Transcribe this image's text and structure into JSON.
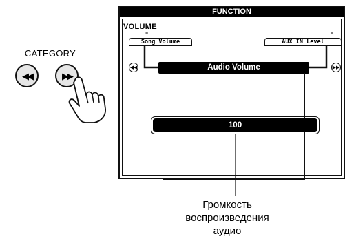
{
  "left_panel": {
    "category_label": "CATEGORY",
    "prev_button": {
      "icon": "rewind-icon",
      "glyph": "◀◀"
    },
    "next_button": {
      "icon": "fast-forward-icon",
      "glyph": "▶▶"
    },
    "pointer_icon": "hand-pointer-icon"
  },
  "lcd": {
    "header": "FUNCTION",
    "category": "VOLUME",
    "left_tab": "Song Volume",
    "right_tab": "AUX IN Level",
    "tick": "≡",
    "left_arrow_glyph": "◀◀",
    "right_arrow_glyph": "▶▶",
    "selected_item": "Audio Volume",
    "value": "100"
  },
  "caption": {
    "line1": "Громкость",
    "line2": "воспроизведения",
    "line3": "аудио"
  },
  "colors": {
    "background": "#ffffff",
    "lcd_black": "#000000",
    "button_fill": "#e6e6e6"
  }
}
